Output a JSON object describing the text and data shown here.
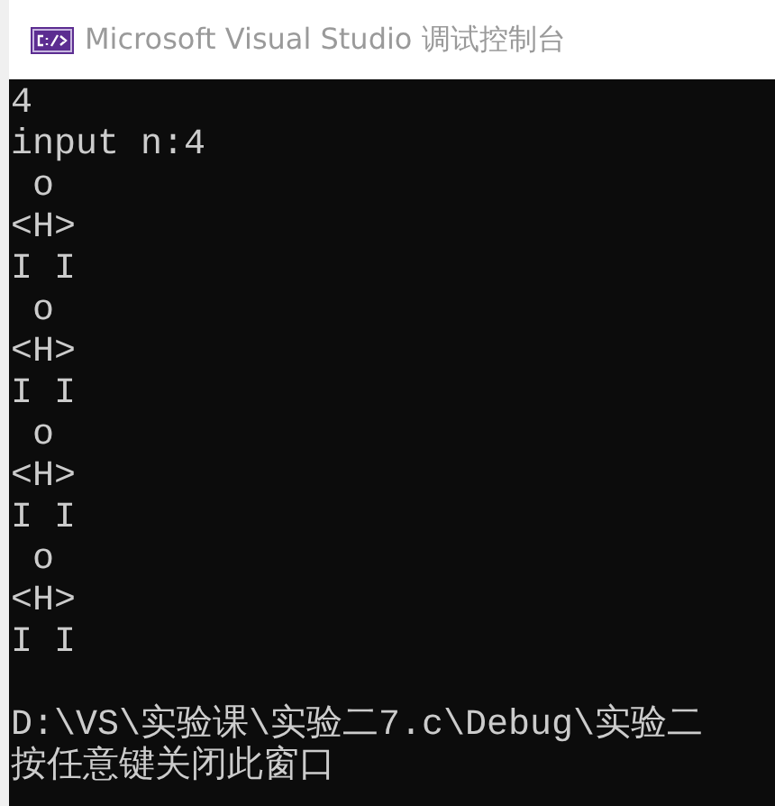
{
  "window": {
    "title": "Microsoft Visual Studio 调试控制台"
  },
  "console": {
    "lines": [
      {
        "kind": "text",
        "text": "4"
      },
      {
        "kind": "text",
        "text": "input n:4"
      },
      {
        "kind": "text",
        "text": " o"
      },
      {
        "kind": "text",
        "text": "<H>"
      },
      {
        "kind": "text",
        "text": "I I"
      },
      {
        "kind": "text",
        "text": " o"
      },
      {
        "kind": "text",
        "text": "<H>"
      },
      {
        "kind": "text",
        "text": "I I"
      },
      {
        "kind": "text",
        "text": " o"
      },
      {
        "kind": "text",
        "text": "<H>"
      },
      {
        "kind": "text",
        "text": "I I"
      },
      {
        "kind": "text",
        "text": " o"
      },
      {
        "kind": "text",
        "text": "<H>"
      },
      {
        "kind": "text",
        "text": "I I"
      },
      {
        "kind": "blank"
      },
      {
        "kind": "text",
        "text": "D:\\VS\\实验课\\实验二7.c\\Debug\\实验二"
      },
      {
        "kind": "text",
        "text": "按任意键关闭此窗口"
      }
    ]
  }
}
